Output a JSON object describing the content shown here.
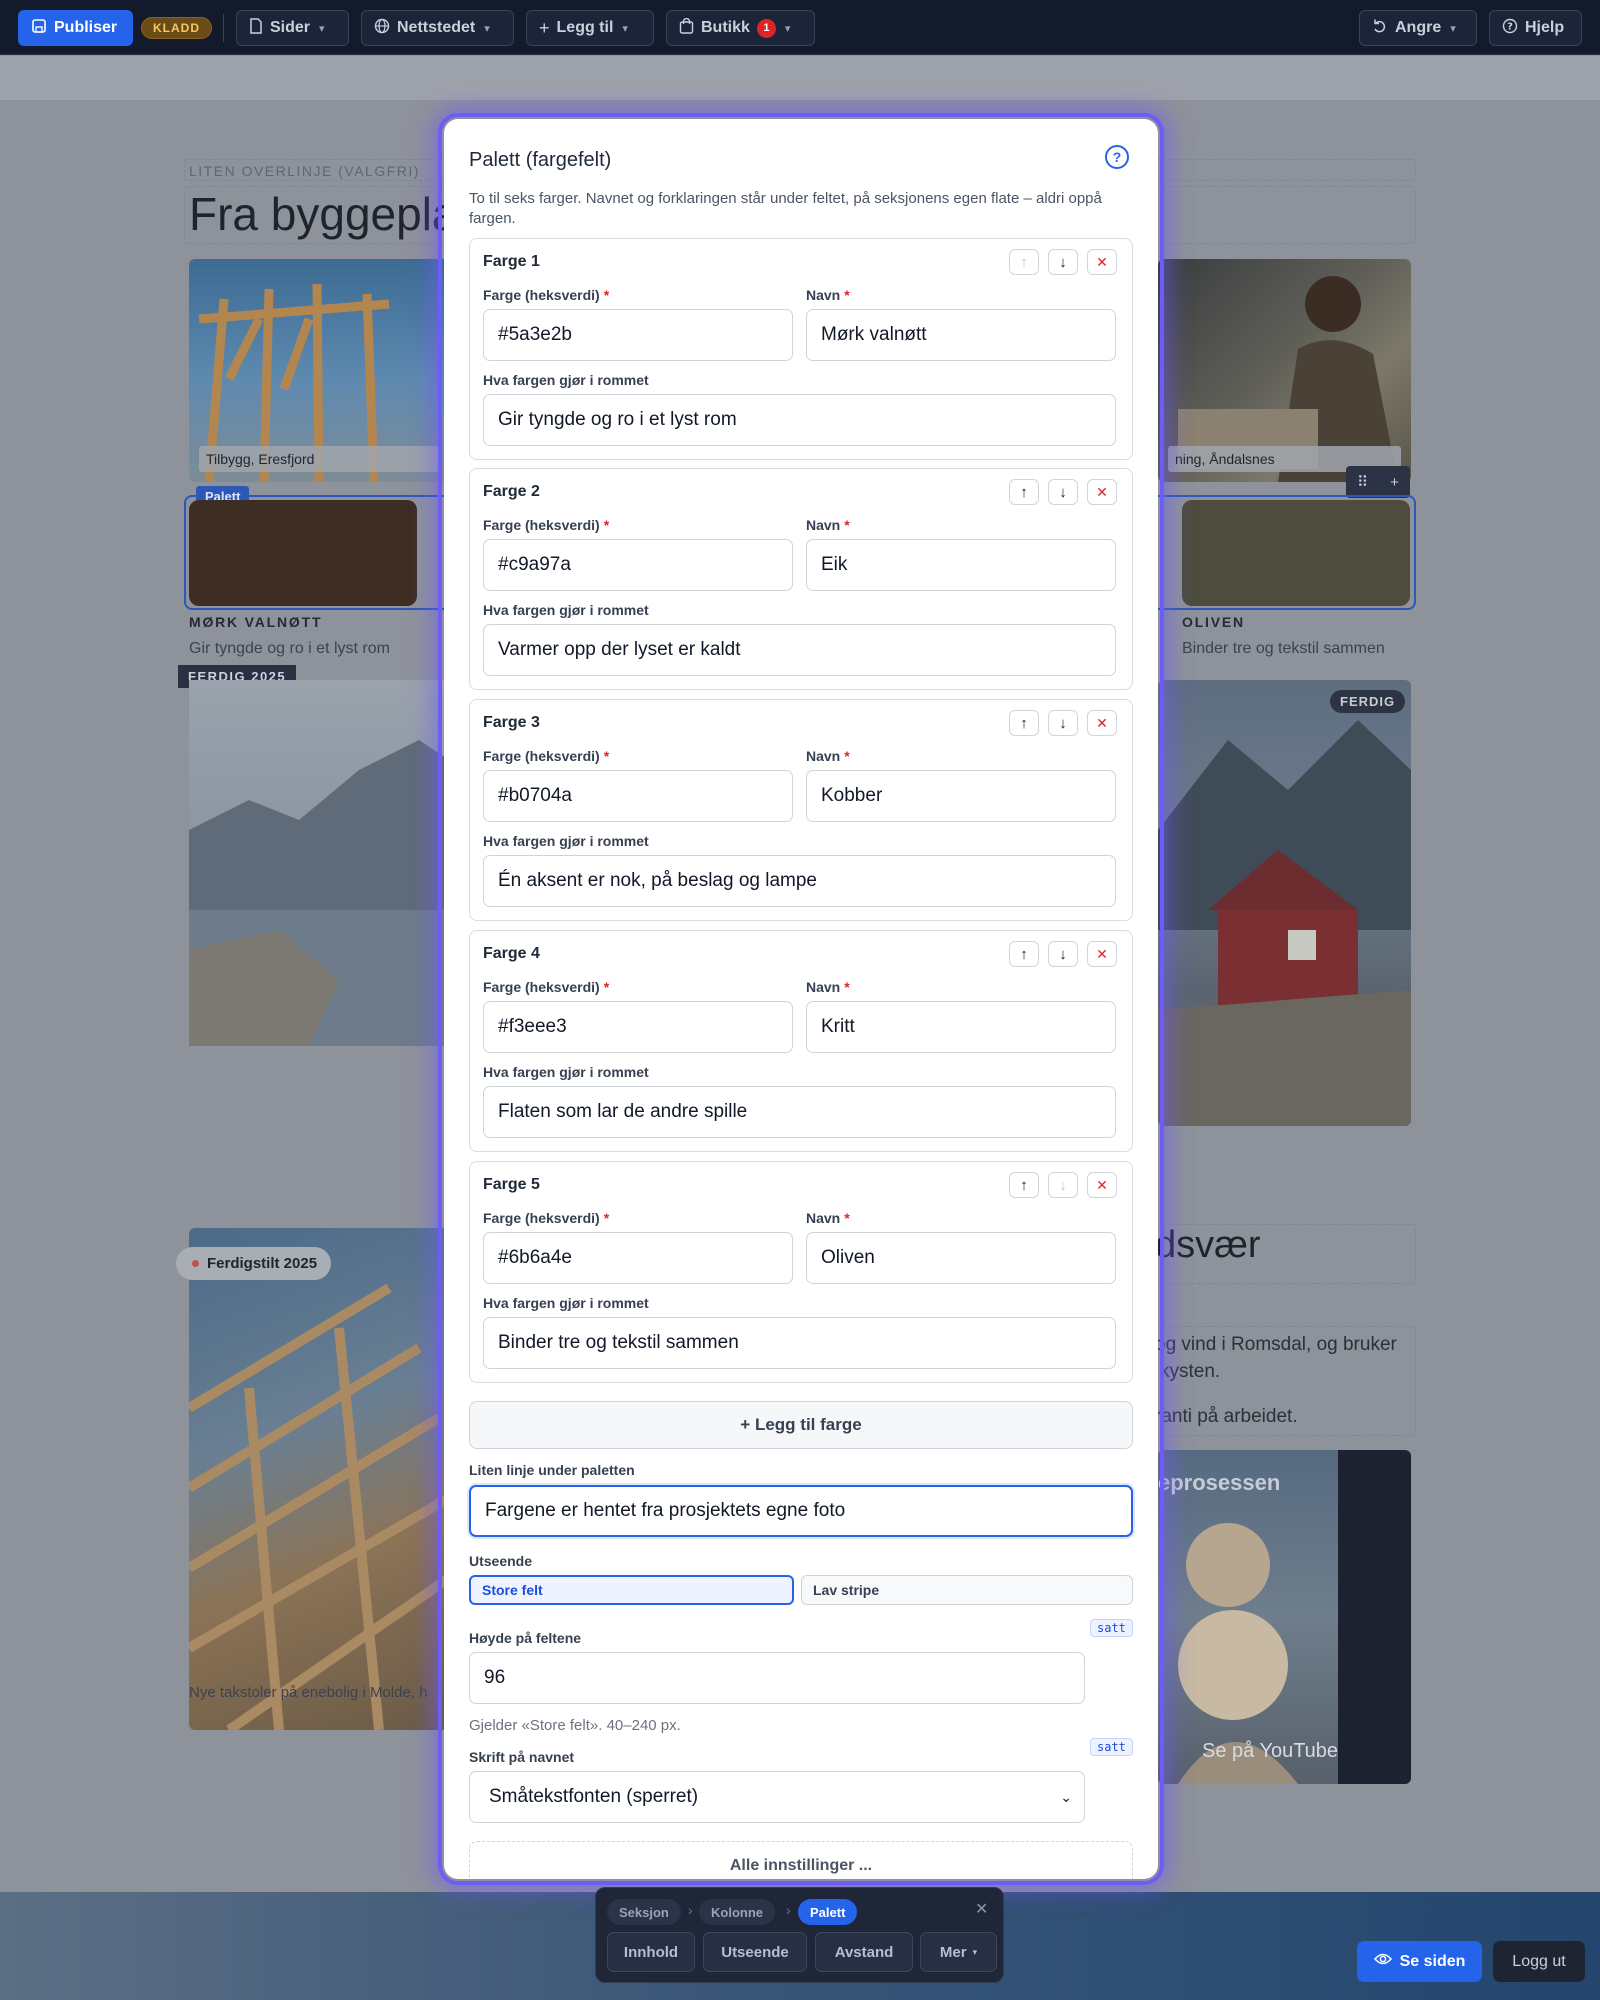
{
  "topbar": {
    "publish": "Publiser",
    "draft": "KLADD",
    "pages": "Sider",
    "site": "Nettstedet",
    "add": "Legg til",
    "shop": "Butikk",
    "shop_count": "1",
    "undo": "Angre",
    "help": "Hjelp"
  },
  "background": {
    "overline": "LITEN OVERLINJE (VALGFRI)",
    "heading": "Fra byggeplas",
    "photo1_caption": "Tilbygg, Eresfjord",
    "photo2_caption": "ning, Åndalsnes",
    "palette_tag": "Palett",
    "swatch1_name": "MØRK VALNØTT",
    "swatch1_desc": "Gir tyngde og ro i et lyst rom",
    "swatch5_name": "OLIVEN",
    "swatch5_desc": "Binder tre og tekstil sammen",
    "ferdig_2025": "FERDIG 2025",
    "ferdig": "FERDIG",
    "ferdigstilt": "Ferdigstilt 2025",
    "heading2": "dsvær",
    "body_line1": "og vind i Romsdal, og bruker",
    "body_line2": "kysten.",
    "body_line3": "ranti på arbeidet.",
    "video_title": "eprosessen",
    "video_youtube": "Se på  YouTube",
    "caption_bottom": "Nye takstoler på enebolig i Molde, h",
    "colors": {
      "walnut": "#5a3e2b",
      "olive": "#6b6a4e"
    }
  },
  "dialog": {
    "title": "Palett (fargefelt)",
    "intro": "To til seks farger. Navnet og forklaringen står under feltet, på seksjonens egen flate – aldri oppå fargen.",
    "hex_label": "Farge (heksverdi)",
    "name_label": "Navn",
    "desc_label": "Hva fargen gjør i rommet",
    "colors": [
      {
        "title": "Farge 1",
        "hex": "#5a3e2b",
        "name": "Mørk valnøtt",
        "desc": "Gir tyngde og ro i et lyst rom"
      },
      {
        "title": "Farge 2",
        "hex": "#c9a97a",
        "name": "Eik",
        "desc": "Varmer opp der lyset er kaldt"
      },
      {
        "title": "Farge 3",
        "hex": "#b0704a",
        "name": "Kobber",
        "desc": "Én aksent er nok, på beslag og lampe"
      },
      {
        "title": "Farge 4",
        "hex": "#f3eee3",
        "name": "Kritt",
        "desc": "Flaten som lar de andre spille"
      },
      {
        "title": "Farge 5",
        "hex": "#6b6a4e",
        "name": "Oliven",
        "desc": "Binder tre og tekstil sammen"
      }
    ],
    "add_color": "+ Legg til farge",
    "caption_label": "Liten linje under paletten",
    "caption_value": "Fargene er hentet fra prosjektets egne foto",
    "appearance_label": "Utseende",
    "appearance_options": [
      "Store felt",
      "Lav stripe"
    ],
    "height_label": "Høyde på feltene",
    "height_value": "96",
    "height_hint": "Gjelder «Store felt». 40–240 px.",
    "set_badge": "satt",
    "font_label": "Skrift på navnet",
    "font_value": "Småtekstfonten (sperret)",
    "all_settings": "Alle innstillinger ..."
  },
  "toolbar": {
    "crumbs": [
      "Seksjon",
      "Kolonne",
      "Palett"
    ],
    "buttons": [
      "Innhold",
      "Utseende",
      "Avstand",
      "Mer"
    ],
    "view_site": "Se siden",
    "logout": "Logg ut"
  },
  "accent": "#2563eb"
}
